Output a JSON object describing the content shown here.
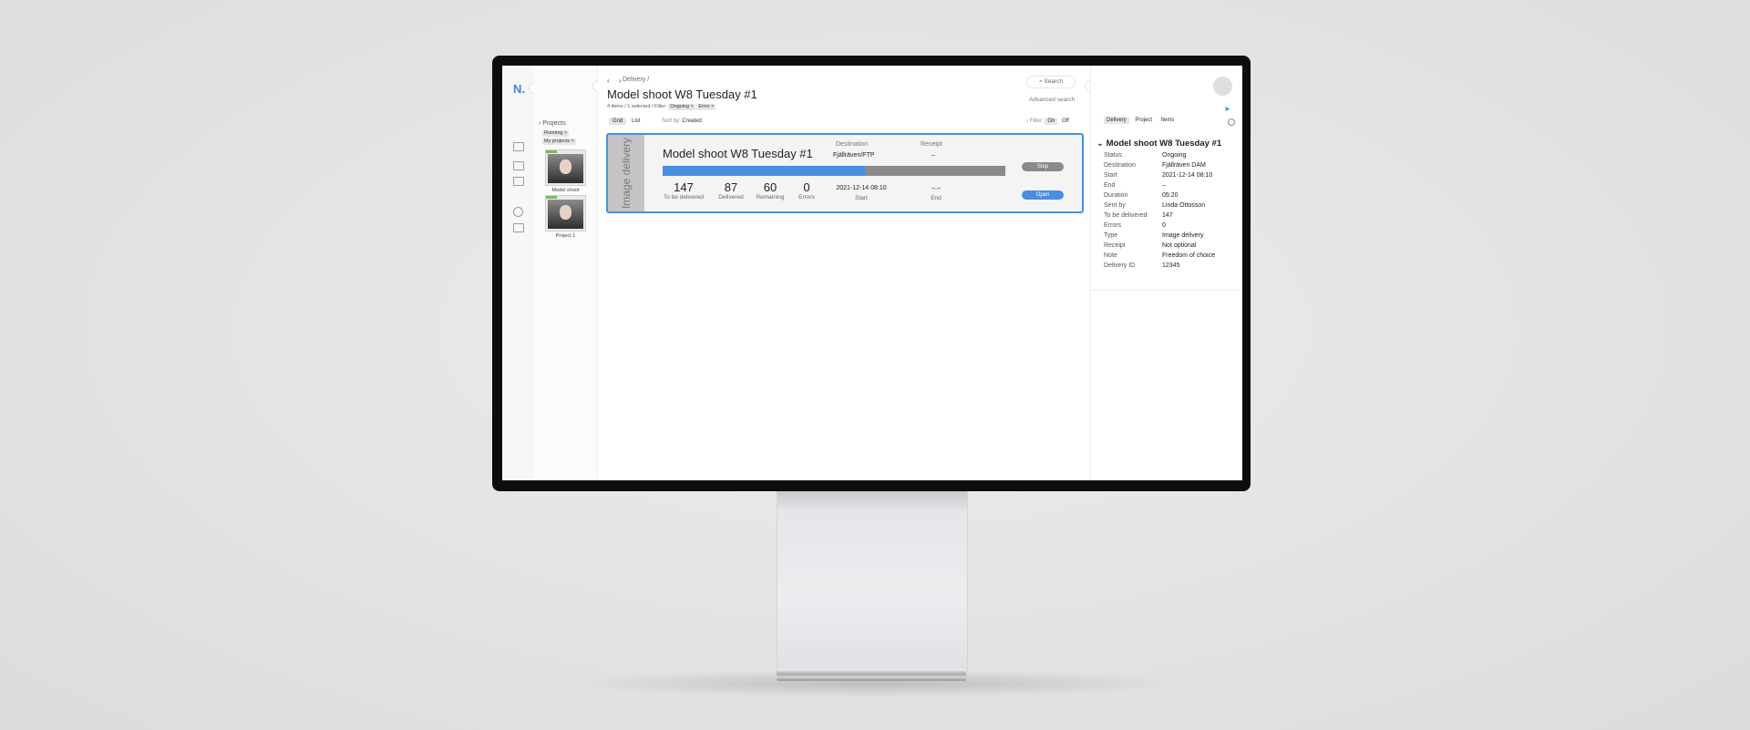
{
  "app": {
    "logo": "N."
  },
  "sidebar": {
    "projects_label": "Projects",
    "filters": [
      "Running ×",
      "My projects ×"
    ],
    "items": [
      {
        "label": "Model shoot"
      },
      {
        "label": "Project 1"
      }
    ]
  },
  "main": {
    "breadcrumb": "Delivery /",
    "title": "Model shoot W8 Tuesday #1",
    "subtitle": "4 items / 1 selected / Filter:",
    "filter_chips": [
      "Ongoing ×",
      "Error ×"
    ],
    "views": [
      "Grid",
      "List"
    ],
    "active_view": "Grid",
    "sort_by_label": "Sort by:",
    "sort_by_value": "Created",
    "search_label": "Search",
    "advanced_search": "Advanced search",
    "filter_label": "Filter:",
    "filter_on": "On",
    "filter_off": "Off"
  },
  "card": {
    "side_label": "Image delivery",
    "title": "Model shoot W8 Tuesday #1",
    "destination_label": "Destination",
    "destination_value": "Fjällräven/FTP",
    "receipt_label": "Receipt",
    "receipt_value": "–",
    "progress": 0.59,
    "stats": [
      {
        "value": "147",
        "label": "To be delivered"
      },
      {
        "value": "87",
        "label": "Delivered"
      },
      {
        "value": "60",
        "label": "Remaining"
      },
      {
        "value": "0",
        "label": "Errors"
      }
    ],
    "start_value": "2021-12-14 08:10",
    "start_label": "Start",
    "end_value": "–.–",
    "end_label": "End",
    "stop_label": "Stop",
    "open_label": "Open"
  },
  "panel": {
    "tabs": [
      "Delivery",
      "Project",
      "Items"
    ],
    "active_tab": "Delivery",
    "heading": "Model shoot W8 Tuesday #1",
    "rows": [
      {
        "k": "Status",
        "v": "Ongoing"
      },
      {
        "k": "Destination",
        "v": "Fjällräven DAM"
      },
      {
        "k": "Start",
        "v": "2021-12-14 08:10"
      },
      {
        "k": "End",
        "v": "–"
      },
      {
        "k": "Duration",
        "v": "05:20"
      },
      {
        "k": "Sent by",
        "v": "Linda Ottosson"
      },
      {
        "k": "To be delivered",
        "v": "147"
      },
      {
        "k": "Errors",
        "v": "0"
      },
      {
        "k": "Type",
        "v": "Image delivery"
      },
      {
        "k": "Receipt",
        "v": "Not optional"
      },
      {
        "k": "Note",
        "v": "Freedom of choice"
      },
      {
        "k": "Delivery ID",
        "v": "12345"
      }
    ]
  },
  "colors": {
    "accent": "#4a8ee0",
    "bar_bg": "#8a8a8c",
    "bezel": "#0d0d0d"
  }
}
